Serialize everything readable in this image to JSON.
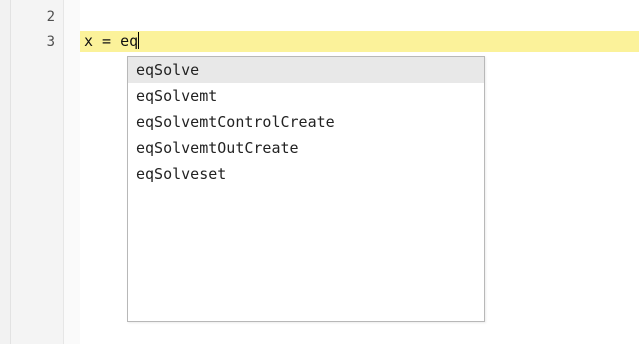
{
  "editor": {
    "line_numbers": [
      "2",
      "3"
    ],
    "code": {
      "line3": "x = eq"
    }
  },
  "autocomplete": {
    "selected_index": 0,
    "items": [
      {
        "label": "eqSolve"
      },
      {
        "label": "eqSolvemt"
      },
      {
        "label": "eqSolvemtControlCreate"
      },
      {
        "label": "eqSolvemtOutCreate"
      },
      {
        "label": "eqSolveset"
      }
    ]
  },
  "colors": {
    "current_line_highlight": "#fbf29a",
    "selected_item_background": "#e8e8e8",
    "gutter_background": "#f4f4f4"
  }
}
